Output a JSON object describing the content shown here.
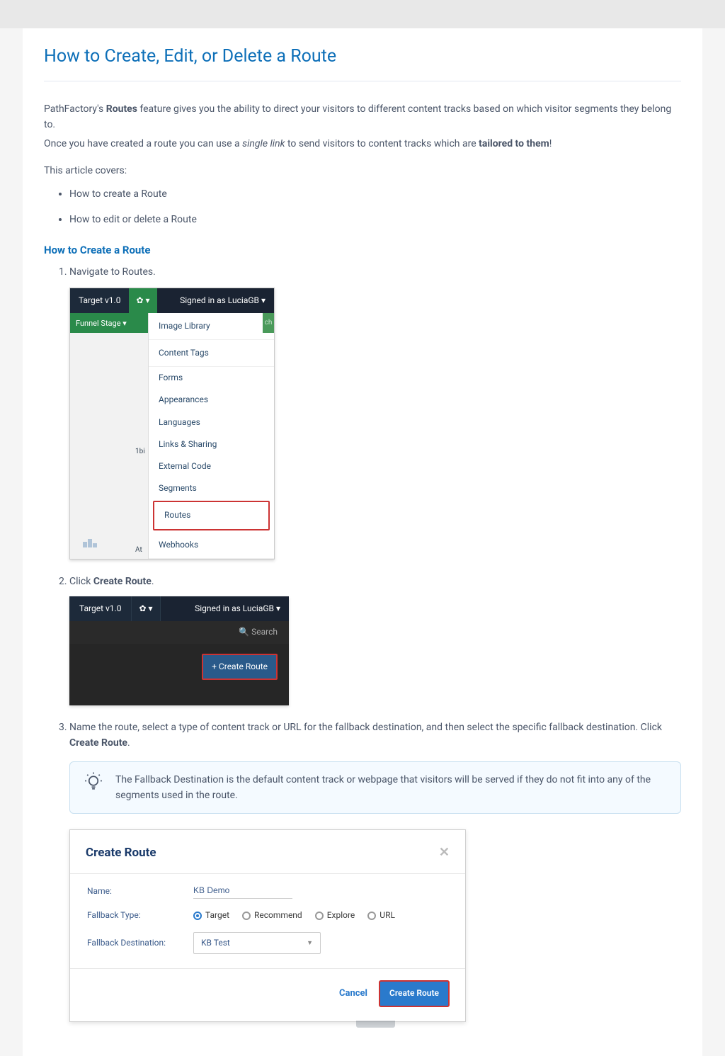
{
  "page": {
    "title": "How to Create, Edit, or Delete a Route",
    "intro_p1_a": "PathFactory's ",
    "intro_p1_b": "Routes",
    "intro_p1_c": " feature gives you the ability to direct your visitors to different content tracks based on which visitor segments they belong to.",
    "intro_p2_a": "Once you have created a route you can use a ",
    "intro_p2_b": "single link",
    "intro_p2_c": " to send visitors to content tracks which are ",
    "intro_p2_d": "tailored to them",
    "intro_p2_e": "!",
    "covers_label": "This article covers:",
    "covers_items": [
      "How to create a Route",
      "How to edit or delete a Route"
    ],
    "section_create_title": "How to Create a Route"
  },
  "steps": {
    "s1": "Navigate to Routes.",
    "s2_a": "Click ",
    "s2_b": "Create Route",
    "s2_c": ".",
    "s3_a": "Name the route, select a type of content track or URL for the fallback destination, and then select the specific fallback destination. Click ",
    "s3_b": "Create Route",
    "s3_c": "."
  },
  "tip": {
    "text": "The Fallback Destination is the default content track or webpage that visitors will be served if they do not fit into any of the segments used in the route."
  },
  "ss1": {
    "target": "Target v1.0",
    "gear": "✿ ▾",
    "signed": "Signed in as LuciaGB ▾",
    "sidebar_label": "Funnel Stage ▾",
    "ch": "ch",
    "label_1bi": "1bi",
    "label_at": "At",
    "menu": {
      "image_library": "Image Library",
      "content_tags": "Content Tags",
      "forms": "Forms",
      "appearances": "Appearances",
      "languages": "Languages",
      "links_sharing": "Links & Sharing",
      "external_code": "External Code",
      "segments": "Segments",
      "routes": "Routes",
      "webhooks": "Webhooks"
    }
  },
  "ss2": {
    "target": "Target v1.0",
    "gear": "✿ ▾",
    "signed": "Signed in as LuciaGB ▾",
    "search": "🔍  Search",
    "create_btn": "+ Create Route"
  },
  "ss3": {
    "title": "Create Route",
    "close": "✕",
    "name_label": "Name:",
    "name_value": "KB Demo",
    "fallback_type_label": "Fallback Type:",
    "radios": {
      "target": "Target",
      "recommend": "Recommend",
      "explore": "Explore",
      "url": "URL"
    },
    "fallback_dest_label": "Fallback Destination:",
    "fallback_dest_value": "KB Test",
    "cancel": "Cancel",
    "submit": "Create Route"
  }
}
